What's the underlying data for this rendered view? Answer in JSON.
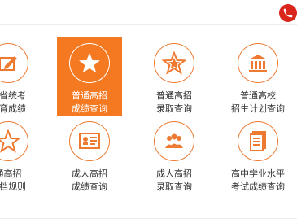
{
  "colors": {
    "accent": "#f47920",
    "icon_stroke": "#ee7a32",
    "phone": "#d9251c",
    "text": "#333333"
  },
  "header": {
    "phone_icon": "phone-icon"
  },
  "tiles": [
    {
      "line1": "招省统考",
      "line2": "体育成绩",
      "icon": "pencil-paper-icon",
      "active": false
    },
    {
      "line1": "普通高招",
      "line2": "成绩查询",
      "icon": "star-icon",
      "active": true
    },
    {
      "line1": "普通高招",
      "line2": "录取查询",
      "icon": "star-outline-icon",
      "active": false
    },
    {
      "line1": "普通高校",
      "line2": "招生计划查询",
      "icon": "institution-icon",
      "active": false
    },
    {
      "line1": "通高招",
      "line2": "段档规则",
      "icon": "star-outline-icon",
      "active": false
    },
    {
      "line1": "成人高招",
      "line2": "成绩查询",
      "icon": "certificate-icon",
      "active": false
    },
    {
      "line1": "成人高招",
      "line2": "录取查询",
      "icon": "group-icon",
      "active": false
    },
    {
      "line1": "高中学业水平",
      "line2": "考试成绩查询",
      "icon": "document-icon",
      "active": false
    }
  ]
}
